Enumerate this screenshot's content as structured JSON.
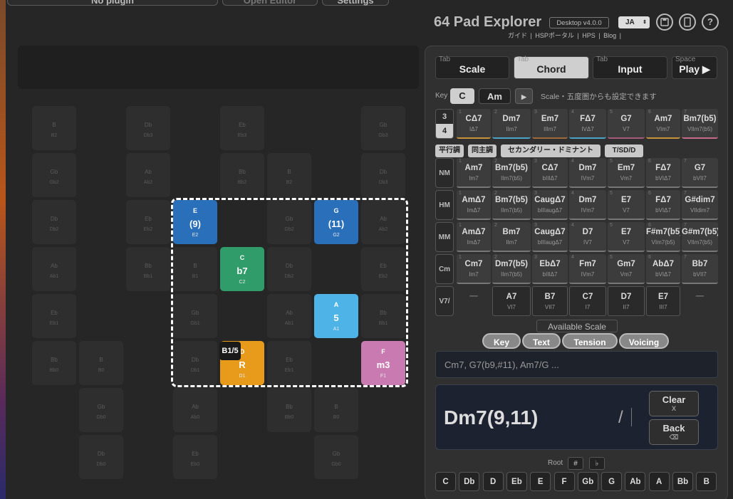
{
  "top_buttons": {
    "plugin": "No plugin",
    "editor": "Open Editor",
    "settings": "Settings"
  },
  "header": {
    "title": "64 Pad Explorer",
    "version": "Desktop v4.0.0",
    "lang": "JA",
    "links": [
      "ガイド",
      "HSPポータル",
      "HPS",
      "Blog"
    ]
  },
  "icons": [
    "save-icon",
    "tablet-icon",
    "help-icon"
  ],
  "pads": [
    {
      "n": "B",
      "s": "B2"
    },
    {
      "n": "Db",
      "s": "Db3"
    },
    {
      "n": "Eb",
      "s": "Eb3"
    },
    {
      "n": "Gb",
      "s": "Gb3"
    },
    {
      "n": "Gb",
      "s": "Gb2"
    },
    {
      "n": "Ab",
      "s": "Ab2"
    },
    {
      "n": "Bb",
      "s": "Bb2"
    },
    {
      "n": "B",
      "s": "B2"
    },
    {
      "n": "Db",
      "s": "Db3"
    },
    {
      "n": "Db",
      "s": "Db2"
    },
    {
      "n": "Eb",
      "s": "Eb2"
    },
    {
      "n": "Gb",
      "s": "Gb2"
    },
    {
      "n": "Ab",
      "s": "Ab2"
    },
    {
      "n": "Ab",
      "s": "Ab1"
    },
    {
      "n": "Bb",
      "s": "Bb1"
    },
    {
      "n": "B",
      "s": "B1"
    },
    {
      "n": "Db",
      "s": "Db2"
    },
    {
      "n": "Eb",
      "s": "Eb2"
    },
    {
      "n": "Eb",
      "s": "Eb1"
    },
    {
      "n": "Gb",
      "s": "Gb1"
    },
    {
      "n": "Ab",
      "s": "Ab1"
    },
    {
      "n": "Bb",
      "s": "Bb1"
    },
    {
      "n": "Bb",
      "s": "Bb0"
    },
    {
      "n": "B",
      "s": "B0"
    },
    {
      "n": "Db",
      "s": "Db1"
    },
    {
      "n": "Eb",
      "s": "Eb1"
    },
    {
      "n": "Gb",
      "s": "Gb0"
    },
    {
      "n": "Ab",
      "s": "Ab0"
    },
    {
      "n": "Bb",
      "s": "Bb0"
    },
    {
      "n": "B",
      "s": "B0"
    },
    {
      "n": "Db",
      "s": "Db0"
    },
    {
      "n": "Eb",
      "s": "Eb0"
    },
    {
      "n": "Gb",
      "s": "Gb0"
    }
  ],
  "active_pads": [
    {
      "n": "E",
      "big": "(9)",
      "s": "E2",
      "color": "#2a6fba"
    },
    {
      "n": "G",
      "big": "(11)",
      "s": "G2",
      "color": "#2a6fba"
    },
    {
      "n": "C",
      "big": "b7",
      "s": "C2",
      "color": "#2f9c6a"
    },
    {
      "n": "A",
      "big": "5",
      "s": "A1",
      "color": "#4eb3e6"
    },
    {
      "n": "D",
      "big": "R",
      "s": "D1",
      "color": "#e89a1a"
    },
    {
      "n": "F",
      "big": "m3",
      "s": "F1",
      "color": "#c97ab0"
    }
  ],
  "bass_badge": "B1/5",
  "tabs": [
    {
      "k": "Tab",
      "label": "Scale"
    },
    {
      "k": "Tab",
      "label": "Chord"
    },
    {
      "k": "Tab",
      "label": "Input"
    },
    {
      "k": "Space",
      "label": "Play ▶"
    }
  ],
  "key_row": {
    "label": "Key",
    "c": "C",
    "am": "Am",
    "play": "▶",
    "hint": "Scale・五度圏からも設定できます"
  },
  "size_toggle": [
    "3",
    "4"
  ],
  "diatonic": [
    {
      "d": "1",
      "c": "CΔ7",
      "r": "IΔ7",
      "bar": "#c8923a"
    },
    {
      "d": "2",
      "c": "Dm7",
      "r": "IIm7",
      "bar": "#4aa3c8"
    },
    {
      "d": "3",
      "c": "Em7",
      "r": "IIIm7",
      "bar": "#a06a3a"
    },
    {
      "d": "4",
      "c": "FΔ7",
      "r": "IVΔ7",
      "bar": "#4aa3c8"
    },
    {
      "d": "5",
      "c": "G7",
      "r": "V7",
      "bar": "#a85a7a"
    },
    {
      "d": "6",
      "c": "Am7",
      "r": "VIm7",
      "bar": "#c8923a"
    },
    {
      "d": "7",
      "c": "Bm7(b5)",
      "r": "VIIm7(b5)",
      "bar": "#c86a8a"
    }
  ],
  "pills": [
    "平行調",
    "同主調",
    "セカンダリー・ドミナント",
    "T/SD/D"
  ],
  "rows": [
    {
      "label": "NM",
      "cells": [
        {
          "d": "1",
          "c": "Am7",
          "r": "Im7"
        },
        {
          "d": "2",
          "c": "Bm7(b5)",
          "r": "IIm7(b5)"
        },
        {
          "d": "3",
          "c": "CΔ7",
          "r": "bIIIΔ7"
        },
        {
          "d": "4",
          "c": "Dm7",
          "r": "IVm7"
        },
        {
          "d": "5",
          "c": "Em7",
          "r": "Vm7"
        },
        {
          "d": "6",
          "c": "FΔ7",
          "r": "bVIΔ7"
        },
        {
          "d": "7",
          "c": "G7",
          "r": "bVII7"
        }
      ]
    },
    {
      "label": "HM",
      "cells": [
        {
          "d": "1",
          "c": "AmΔ7",
          "r": "ImΔ7"
        },
        {
          "d": "2",
          "c": "Bm7(b5)",
          "r": "IIm7(b5)"
        },
        {
          "d": "3",
          "c": "CaugΔ7",
          "r": "bIIIaugΔ7"
        },
        {
          "d": "4",
          "c": "Dm7",
          "r": "IVm7"
        },
        {
          "d": "5",
          "c": "E7",
          "r": "V7"
        },
        {
          "d": "6",
          "c": "FΔ7",
          "r": "bVIΔ7"
        },
        {
          "d": "7",
          "c": "G#dim7",
          "r": "VIIdim7"
        }
      ]
    },
    {
      "label": "MM",
      "cells": [
        {
          "d": "1",
          "c": "AmΔ7",
          "r": "ImΔ7"
        },
        {
          "d": "2",
          "c": "Bm7",
          "r": "IIm7"
        },
        {
          "d": "3",
          "c": "CaugΔ7",
          "r": "bIIIaugΔ7"
        },
        {
          "d": "4",
          "c": "D7",
          "r": "IV7"
        },
        {
          "d": "5",
          "c": "E7",
          "r": "V7"
        },
        {
          "d": "6",
          "c": "F#m7(b5)",
          "r": "VIm7(b5)"
        },
        {
          "d": "7",
          "c": "G#m7(b5)",
          "r": "VIIm7(b5)"
        }
      ]
    },
    {
      "label": "Cm",
      "cells": [
        {
          "d": "1",
          "c": "Cm7",
          "r": "Im7"
        },
        {
          "d": "2",
          "c": "Dm7(b5)",
          "r": "IIm7(b5)"
        },
        {
          "d": "3",
          "c": "EbΔ7",
          "r": "bIIIΔ7"
        },
        {
          "d": "4",
          "c": "Fm7",
          "r": "IVm7"
        },
        {
          "d": "5",
          "c": "Gm7",
          "r": "Vm7"
        },
        {
          "d": "6",
          "c": "AbΔ7",
          "r": "bVIΔ7"
        },
        {
          "d": "7",
          "c": "Bb7",
          "r": "bVII7"
        }
      ]
    }
  ],
  "v7_row": {
    "label": "V7/",
    "cells": [
      {
        "c": "—",
        "r": ""
      },
      {
        "c": "A7",
        "r": "VI7"
      },
      {
        "c": "B7",
        "r": "VII7"
      },
      {
        "c": "C7",
        "r": "I7"
      },
      {
        "c": "D7",
        "r": "II7"
      },
      {
        "c": "E7",
        "r": "III7"
      },
      {
        "c": "—",
        "r": ""
      }
    ]
  },
  "available_scale": "Available Scale",
  "radio": [
    "Key",
    "Text",
    "Tension",
    "Voicing"
  ],
  "input_placeholder": "Cm7, G7(b9,#11), Am7/G ...",
  "chord_display": "Dm7(9,11)",
  "slash": "/",
  "clear": {
    "label": "Clear",
    "sub": "X"
  },
  "back": {
    "label": "Back",
    "sub": "⌫"
  },
  "root_row": {
    "label": "Root",
    "sharp": "#",
    "flat": "♭"
  },
  "notes": [
    "C",
    "Db",
    "D",
    "Eb",
    "E",
    "F",
    "Gb",
    "G",
    "Ab",
    "A",
    "Bb",
    "B"
  ]
}
